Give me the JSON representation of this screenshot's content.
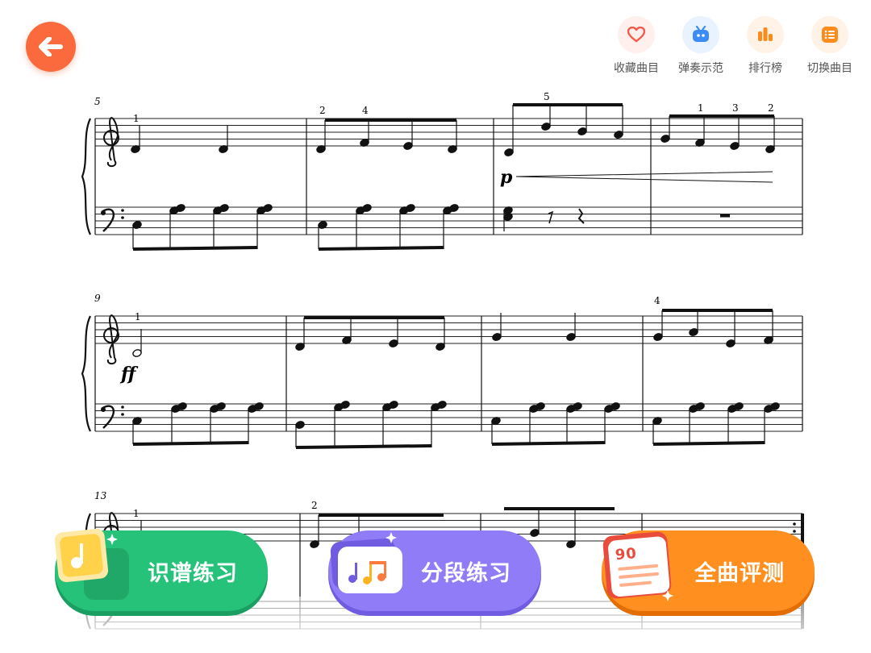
{
  "header": {
    "back_label": "",
    "actions": [
      {
        "label": "收藏曲目",
        "icon": "heart-icon",
        "bg": "#fff0ee",
        "color": "#f45a4a"
      },
      {
        "label": "弹奏示范",
        "icon": "tv-icon",
        "bg": "#e9f2ff",
        "color": "#3b8df5"
      },
      {
        "label": "排行榜",
        "icon": "ranking-bars-icon",
        "bg": "#fff3e8",
        "color": "#fb8c1c"
      },
      {
        "label": "切换曲目",
        "icon": "list-icon",
        "bg": "#fff3e8",
        "color": "#fb8c1c"
      }
    ]
  },
  "score": {
    "measure_numbers": [
      "5",
      "9",
      "13"
    ],
    "fingerings": {
      "row1": [
        "1",
        "2",
        "4",
        "5",
        "1",
        "3",
        "2"
      ],
      "row2": [
        "1",
        "4"
      ],
      "row3": [
        "1",
        "2"
      ]
    },
    "dynamics": [
      "p",
      "ff"
    ]
  },
  "practice_buttons": [
    {
      "label": "识谱练习",
      "color": "#26c27a",
      "icon": "note-card-icon"
    },
    {
      "label": "分段练习",
      "color": "#8f7cf6",
      "icon": "music-notes-card-icon"
    },
    {
      "label": "全曲评测",
      "color": "#ff8f1f",
      "icon": "score-book-icon",
      "badge": "90"
    }
  ]
}
